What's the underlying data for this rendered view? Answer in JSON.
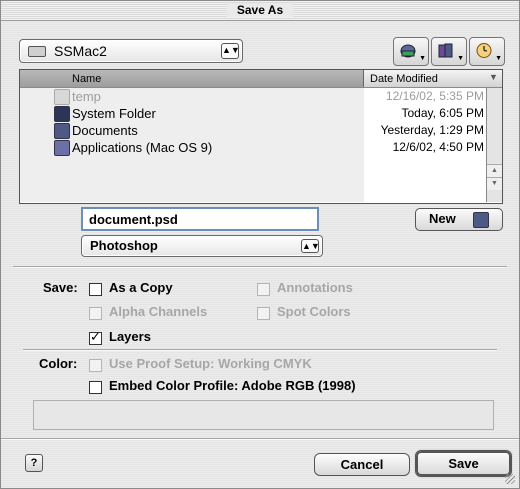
{
  "window": {
    "title": "Save As"
  },
  "location": {
    "volume": "SSMac2",
    "volume_icon": "hard-disk-icon",
    "toolbar_icons": [
      "shortcuts-icon",
      "favorites-icon",
      "recent-icon"
    ]
  },
  "browser": {
    "columns": {
      "name": "Name",
      "date": "Date Modified"
    },
    "rows": [
      {
        "name": "temp",
        "date": "12/16/02, 5:35 PM",
        "enabled": false,
        "icon": "folder-icon"
      },
      {
        "name": "System Folder",
        "date": "Today, 6:05 PM",
        "enabled": true,
        "icon": "system-folder-icon"
      },
      {
        "name": "Documents",
        "date": "Yesterday, 1:29 PM",
        "enabled": true,
        "icon": "folder-icon"
      },
      {
        "name": "Applications (Mac OS 9)",
        "date": "12/6/02, 4:50 PM",
        "enabled": true,
        "icon": "applications-folder-icon"
      }
    ]
  },
  "file": {
    "name": "document.psd",
    "format": "Photoshop",
    "new_label": "New"
  },
  "options": {
    "save_label": "Save:",
    "as_a_copy": {
      "label": "As a Copy",
      "checked": false,
      "enabled": true
    },
    "annotations": {
      "label": "Annotations",
      "checked": false,
      "enabled": false
    },
    "alpha_channels": {
      "label": "Alpha Channels",
      "checked": false,
      "enabled": false
    },
    "spot_colors": {
      "label": "Spot Colors",
      "checked": false,
      "enabled": false
    },
    "layers": {
      "label": "Layers",
      "checked": true,
      "enabled": true
    },
    "color_label": "Color:",
    "use_proof_setup": {
      "label": "Use Proof Setup: Working CMYK",
      "checked": false,
      "enabled": false
    },
    "embed_profile": {
      "label": "Embed Color Profile: Adobe RGB (1998)",
      "checked": false,
      "enabled": true
    }
  },
  "footer": {
    "help_label": "?",
    "cancel_label": "Cancel",
    "save_label": "Save"
  }
}
